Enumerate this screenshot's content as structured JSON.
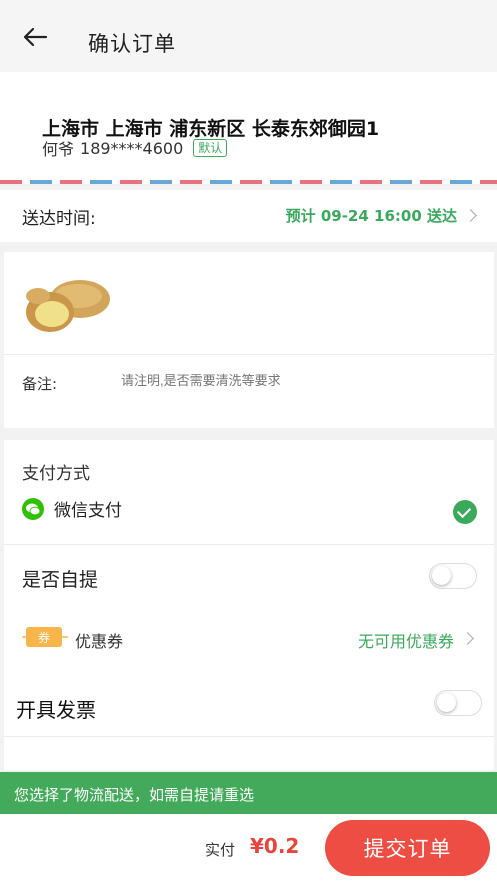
{
  "header": {
    "title": "确认订单",
    "back_icon": "arrow-left-icon"
  },
  "address": {
    "full": "上海市 上海市 浦东新区 长泰东郊御园1",
    "name": "何爷",
    "phone": "189****4600",
    "default_badge": "默认"
  },
  "delivery": {
    "label": "送达时间:",
    "value": "预计 09-24 16:00 送达"
  },
  "goods": {
    "image_icon": "potato-image",
    "note_label": "备注:",
    "note_placeholder": "请注明,是否需要清洗等要求"
  },
  "payment": {
    "heading": "支付方式",
    "method": "微信支付",
    "method_icon": "wechat-icon",
    "selected": true
  },
  "self_pickup": {
    "label": "是否自提",
    "on": false
  },
  "coupon": {
    "icon_text": "券",
    "label": "优惠券",
    "value": "无可用优惠券"
  },
  "invoice": {
    "label": "开具发票",
    "on": false
  },
  "tip": {
    "text": "您选择了物流配送，如需自提请重选"
  },
  "footer": {
    "paid_label": "实付",
    "amount": "¥0.2",
    "submit": "提交订单"
  },
  "colors": {
    "accent": "#3aa95c",
    "danger": "#ee4d43",
    "tip_bg": "#43a95b"
  }
}
